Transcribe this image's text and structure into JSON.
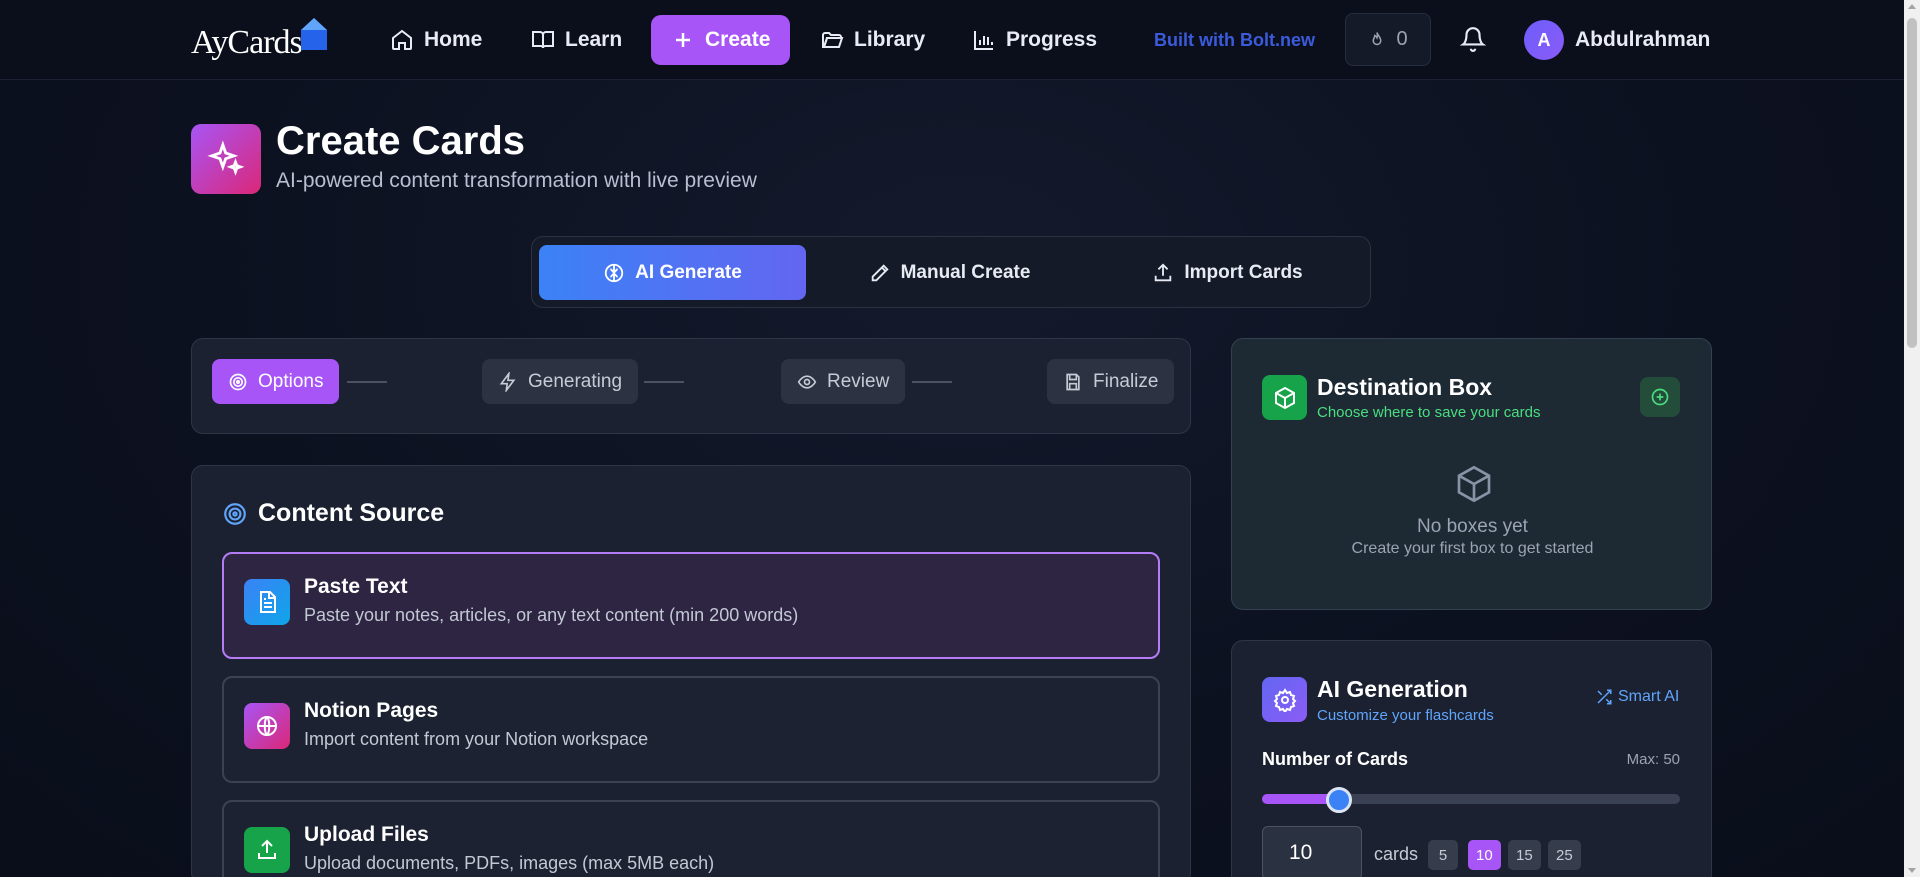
{
  "nav": {
    "logo": "AyCards",
    "items": [
      {
        "label": "Home",
        "icon": "home-icon"
      },
      {
        "label": "Learn",
        "icon": "book-icon"
      },
      {
        "label": "Create",
        "icon": "plus-icon"
      },
      {
        "label": "Library",
        "icon": "folder-icon"
      },
      {
        "label": "Progress",
        "icon": "bar-chart-icon"
      }
    ],
    "built_with": "Built with Bolt.new",
    "streak_count": "0",
    "user_initial": "A",
    "user_name": "Abdulrahman"
  },
  "header": {
    "title": "Create Cards",
    "subtitle": "AI-powered content transformation with live preview"
  },
  "mode_tabs": [
    {
      "label": "AI Generate",
      "active": true
    },
    {
      "label": "Manual Create",
      "active": false
    },
    {
      "label": "Import Cards",
      "active": false
    }
  ],
  "steps": [
    {
      "label": "Options",
      "active": true
    },
    {
      "label": "Generating",
      "active": false
    },
    {
      "label": "Review",
      "active": false
    },
    {
      "label": "Finalize",
      "active": false
    }
  ],
  "content_source": {
    "title": "Content Source",
    "options": [
      {
        "name": "Paste Text",
        "description": "Paste your notes, articles, or any text content (min 200 words)",
        "selected": true
      },
      {
        "name": "Notion Pages",
        "description": "Import content from your Notion workspace",
        "selected": false
      },
      {
        "name": "Upload Files",
        "description": "Upload documents, PDFs, images (max 5MB each)",
        "selected": false
      }
    ]
  },
  "destination": {
    "title": "Destination Box",
    "subtitle": "Choose where to save your cards",
    "empty_title": "No boxes yet",
    "empty_sub": "Create your first box to get started"
  },
  "ai_generation": {
    "title": "AI Generation",
    "subtitle": "Customize your flashcards",
    "smart_ai": "Smart AI",
    "count_label": "Number of Cards",
    "max_label": "Max: 50",
    "count_value": "10",
    "max_value": 50,
    "cards_unit": "cards",
    "presets": [
      "5",
      "10",
      "15",
      "25"
    ],
    "active_preset": "10"
  },
  "colors": {
    "accent": "#a855f7",
    "blue": "#3b82f6",
    "green": "#16a34a"
  }
}
